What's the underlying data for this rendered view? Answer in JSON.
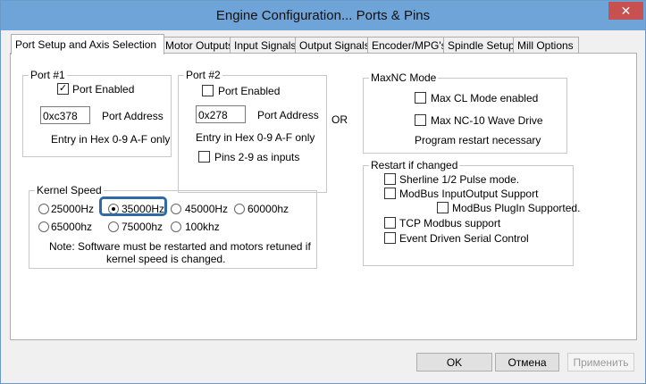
{
  "window": {
    "title": "Engine Configuration... Ports & Pins",
    "close_glyph": "✕"
  },
  "tabs": [
    {
      "label": "Port Setup and Axis Selection"
    },
    {
      "label": "Motor Outputs"
    },
    {
      "label": "Input Signals"
    },
    {
      "label": "Output Signals"
    },
    {
      "label": "Encoder/MPG's"
    },
    {
      "label": "Spindle Setup"
    },
    {
      "label": "Mill Options"
    }
  ],
  "port1": {
    "title": "Port #1",
    "enabled_label": "Port Enabled",
    "enabled": true,
    "address_value": "0xc378",
    "address_label": "Port Address",
    "hint": "Entry in Hex 0-9 A-F only"
  },
  "port2": {
    "title": "Port #2",
    "enabled_label": "Port Enabled",
    "enabled": false,
    "address_value": "0x278",
    "address_label": "Port Address",
    "hint": "Entry in Hex 0-9 A-F only",
    "pins_label": "Pins 2-9 as inputs",
    "pins_checked": false
  },
  "or_label": "OR",
  "maxnc": {
    "title": "MaxNC Mode",
    "cl_label": "Max CL Mode enabled",
    "wave_label": "Max NC-10 Wave Drive",
    "note": "Program restart necessary"
  },
  "kernel": {
    "title": "Kernel Speed",
    "options": [
      "25000Hz",
      "35000Hz",
      "45000Hz",
      "60000hz",
      "65000hz",
      "75000hz",
      "100khz"
    ],
    "selected": "35000Hz",
    "note1": "Note: Software must be restarted and motors retuned if",
    "note2": "kernel speed is changed."
  },
  "restart": {
    "title": "Restart if changed",
    "sherline": "Sherline 1/2 Pulse mode.",
    "modbus_io": "ModBus InputOutput Support",
    "modbus_plugin": "ModBus PlugIn Supported.",
    "tcp_modbus": "TCP Modbus support",
    "event_serial": "Event Driven Serial Control"
  },
  "buttons": {
    "ok": "OK",
    "cancel": "Отмена",
    "apply": "Применить"
  },
  "colors": {
    "title_bar": "#6fa4d8",
    "close_button": "#c75050",
    "highlight": "#2f6aa8"
  }
}
